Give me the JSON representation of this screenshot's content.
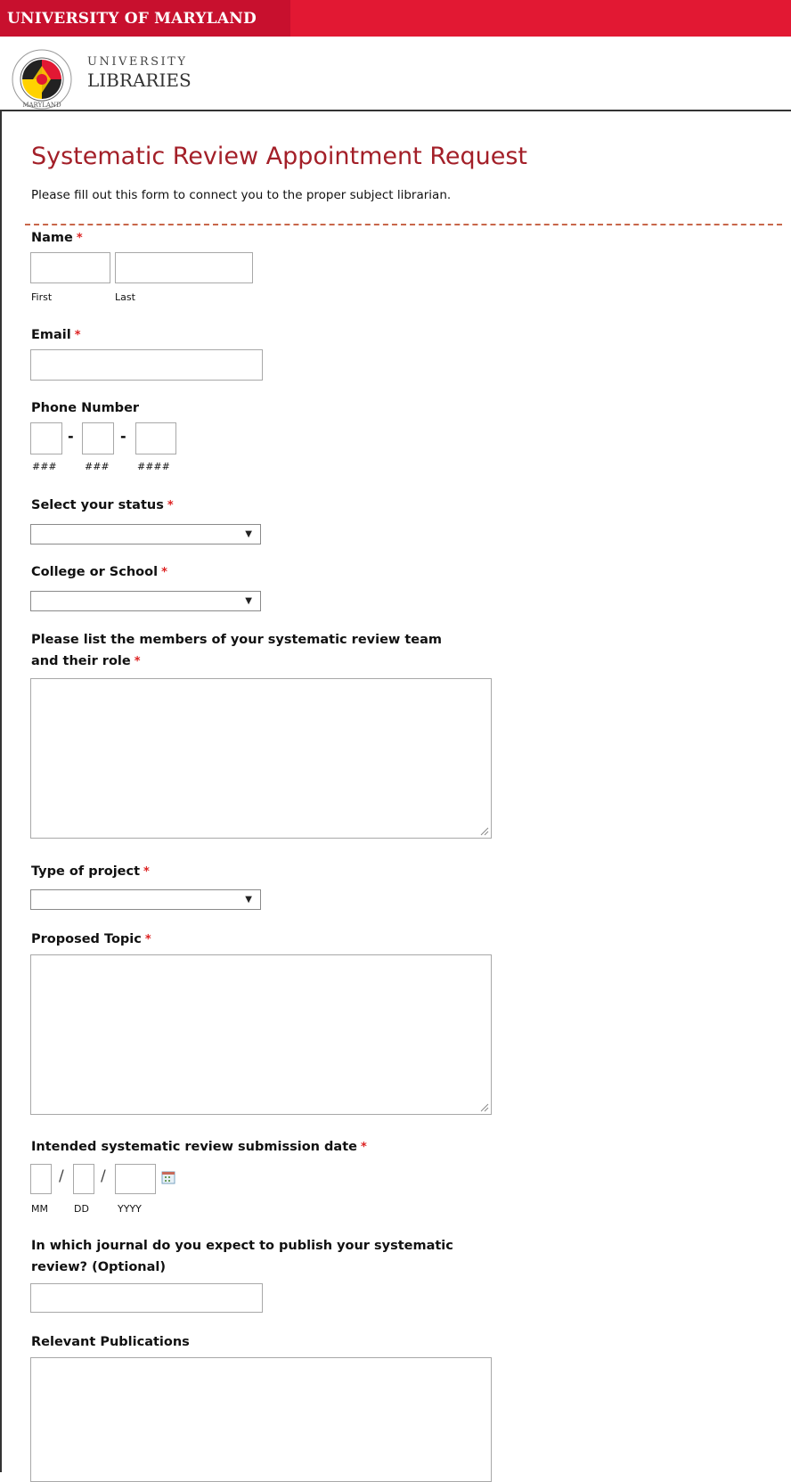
{
  "header": {
    "university_name": "UNIVERSITY OF MARYLAND",
    "libraries_line1": "UNIVERSITY",
    "libraries_line2": "LIBRARIES",
    "seal_text": "MARYLAND",
    "brand_color": "#e21833"
  },
  "form": {
    "title": "Systematic Review Appointment Request",
    "description": "Please fill out this form to connect you to the proper subject librarian.",
    "required_mark": "*",
    "fields": {
      "name": {
        "label": "Name",
        "first_sub": "First",
        "last_sub": "Last",
        "first_value": "",
        "last_value": ""
      },
      "email": {
        "label": "Email",
        "value": ""
      },
      "phone": {
        "label": "Phone Number",
        "dash": "-",
        "sub1": "###",
        "sub2": "###",
        "sub3": "####"
      },
      "status": {
        "label": "Select your status",
        "selected": ""
      },
      "college": {
        "label": "College or School",
        "selected": ""
      },
      "team": {
        "label_line1": "Please list the members of your systematic review team",
        "label_line2": "and their role",
        "value": ""
      },
      "project_type": {
        "label": "Type of project",
        "selected": ""
      },
      "topic": {
        "label": "Proposed Topic",
        "value": ""
      },
      "submission_date": {
        "label": "Intended systematic review submission date",
        "slash": "/",
        "sub_mm": "MM",
        "sub_dd": "DD",
        "sub_yyyy": "YYYY"
      },
      "journal": {
        "label_line1": "In which journal do you expect to publish your systematic",
        "label_line2": "review? (Optional)",
        "value": ""
      },
      "publications": {
        "label": "Relevant Publications",
        "value": ""
      }
    }
  },
  "icons": {
    "select_arrow": "▼",
    "calendar": "calendar-icon",
    "seal": "maryland-seal-icon"
  }
}
